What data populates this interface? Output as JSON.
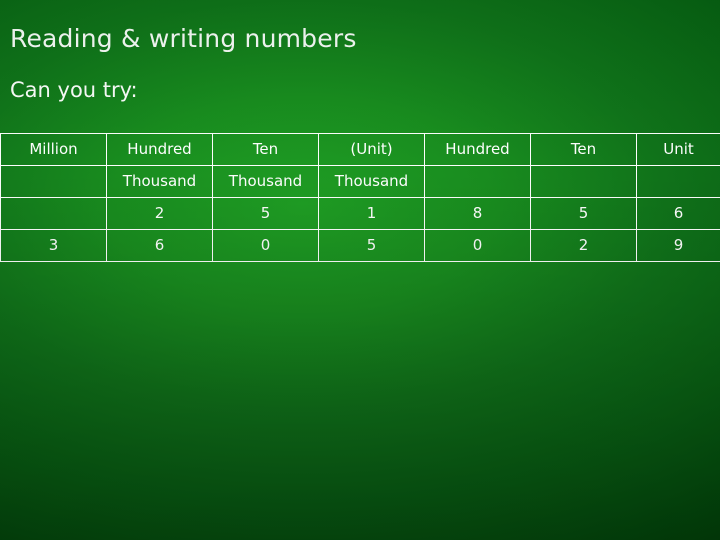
{
  "slide": {
    "title": "Reading & writing numbers",
    "subtitle": "Can you try:",
    "background_color": "#13801c",
    "text_color": "#ffffff"
  },
  "table": {
    "rows": [
      [
        "Million",
        "Hundred",
        "Ten",
        "(Unit)",
        "Hundred",
        "Ten",
        "Unit"
      ],
      [
        "",
        "Thousand",
        "Thousand",
        "Thousand",
        "",
        "",
        ""
      ],
      [
        "",
        "2",
        "5",
        "1",
        "8",
        "5",
        "6"
      ],
      [
        "3",
        "6",
        "0",
        "5",
        "0",
        "2",
        "9"
      ]
    ]
  }
}
